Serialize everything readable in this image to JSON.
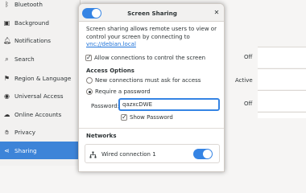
{
  "sidebar": {
    "items": [
      {
        "label": "Bluetooth",
        "icon": "bluetooth-icon"
      },
      {
        "label": "Background",
        "icon": "background-icon"
      },
      {
        "label": "Notifications",
        "icon": "bell-icon"
      },
      {
        "label": "Search",
        "icon": "search-icon"
      },
      {
        "label": "Region & Language",
        "icon": "flag-icon"
      },
      {
        "label": "Universal Access",
        "icon": "accessibility-icon"
      },
      {
        "label": "Online Accounts",
        "icon": "cloud-icon"
      },
      {
        "label": "Privacy",
        "icon": "hand-icon"
      },
      {
        "label": "Sharing",
        "icon": "share-icon",
        "selected": true
      }
    ]
  },
  "background_panel": {
    "status_1": "Off",
    "status_2": "Active",
    "status_3": "Off"
  },
  "dialog": {
    "title": "Screen Sharing",
    "enabled": true,
    "close_icon": "close-icon",
    "description": "Screen sharing allows remote users to view or control your screen by connecting to ",
    "link": "vnc://debian.local",
    "allow_control_label": "Allow connections to control the screen",
    "allow_control_checked": true,
    "access_options_title": "Access Options",
    "option_new_label": "New connections must ask for access",
    "option_password_label": "Require a password",
    "selected_option": "password",
    "password_label": "Password:",
    "password_value": "qazxcDWE",
    "show_password_label": "Show Password",
    "show_password_checked": true,
    "networks_title": "Networks",
    "network_name": "Wired connection 1",
    "network_enabled": true
  },
  "colors": {
    "accent": "#3584e4",
    "selected_row": "#3d84d8",
    "link": "#1c71d8"
  }
}
